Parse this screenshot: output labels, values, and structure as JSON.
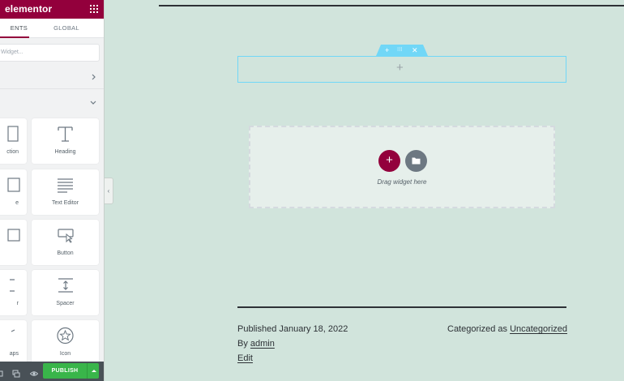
{
  "panel": {
    "logo": "elementor",
    "tabs": {
      "elements": "ENTS",
      "global": "GLOBAL"
    },
    "search_placeholder": "Widget...",
    "widgets": [
      {
        "label": "ction",
        "icon": "section-icon"
      },
      {
        "label": "Heading",
        "icon": "heading-icon"
      },
      {
        "label": "e",
        "icon": "image-icon"
      },
      {
        "label": "Text Editor",
        "icon": "text-editor-icon"
      },
      {
        "label": "",
        "icon": "video-icon"
      },
      {
        "label": "Button",
        "icon": "button-icon"
      },
      {
        "label": "r",
        "icon": "divider-icon"
      },
      {
        "label": "Spacer",
        "icon": "spacer-icon"
      },
      {
        "label": "aps",
        "icon": "google-maps-icon"
      },
      {
        "label": "Icon",
        "icon": "star-icon"
      }
    ],
    "publish_label": "PUBLISH",
    "accent_color": "#93003c",
    "publish_color": "#39b54a"
  },
  "canvas": {
    "section_handle_icons": [
      "plus-icon",
      "drag-handle-icon",
      "close-icon"
    ],
    "section_handle_color": "#71d7f7",
    "add_column_symbol": "+",
    "add_section_symbol": "+",
    "drag_hint": "Drag widget here",
    "post_meta": {
      "published": "Published January 18, 2022",
      "categorized_prefix": "Categorized as",
      "category": "Uncategorized",
      "by_prefix": "By",
      "author": "admin",
      "edit": "Edit"
    }
  }
}
